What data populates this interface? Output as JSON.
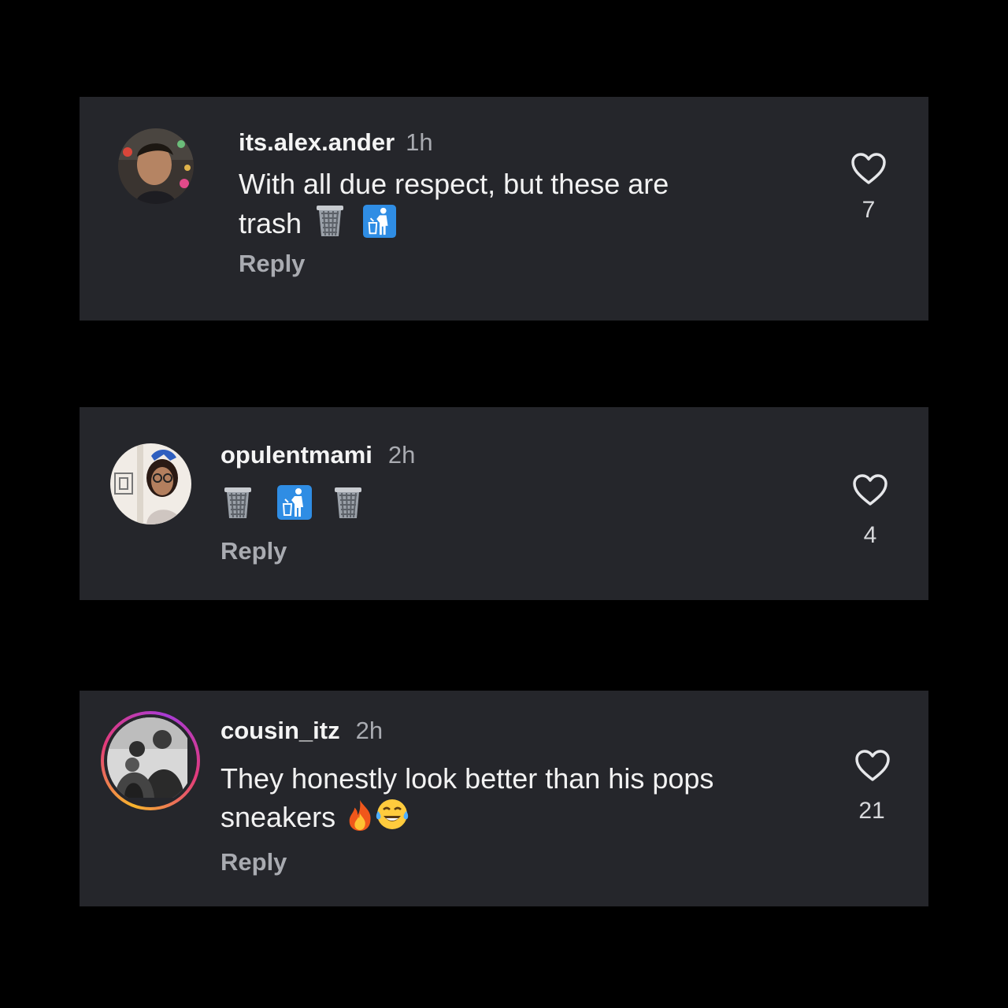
{
  "comments": [
    {
      "username": "its.alex.ander",
      "time": "1h",
      "text": "With all due respect, but these are trash",
      "emojis": [
        "wastebasket",
        "put-litter-in-its-place"
      ],
      "reply_label": "Reply",
      "likes": "7"
    },
    {
      "username": "opulentmami",
      "time": "2h",
      "text": "",
      "emojis": [
        "wastebasket",
        "put-litter-in-its-place",
        "wastebasket"
      ],
      "reply_label": "Reply",
      "likes": "4"
    },
    {
      "username": "cousin_itz",
      "time": "2h",
      "text": "They honestly look better than his pops sneakers",
      "emojis": [
        "fire",
        "face-with-tears-of-joy"
      ],
      "reply_label": "Reply",
      "likes": "21"
    }
  ],
  "icons": {
    "like": "heart-outline-icon"
  },
  "colors": {
    "background": "#000000",
    "card": "#25262b",
    "muted": "#a9abb1",
    "text": "#f2f2f2"
  }
}
